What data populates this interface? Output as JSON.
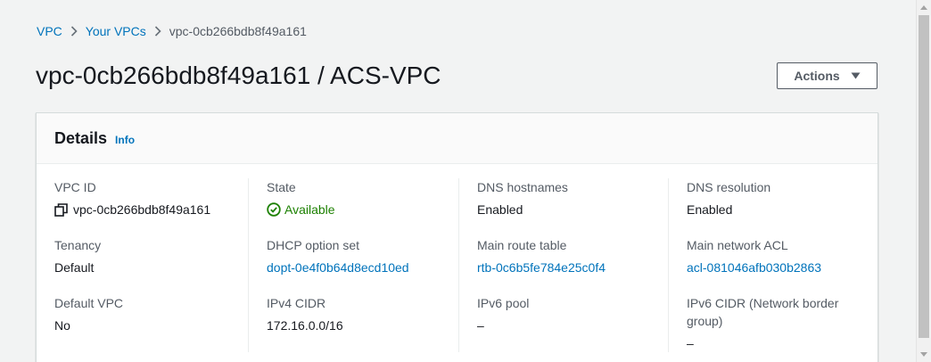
{
  "breadcrumb": {
    "items": [
      {
        "label": "VPC"
      },
      {
        "label": "Your VPCs"
      }
    ],
    "current": "vpc-0cb266bdb8f49a161"
  },
  "page_title": "vpc-0cb266bdb8f49a161 / ACS-VPC",
  "actions_button": {
    "label": "Actions",
    "icon": "caret-down-icon"
  },
  "details": {
    "title": "Details",
    "info_label": "Info",
    "columns": [
      [
        {
          "label": "VPC ID",
          "value": "vpc-0cb266bdb8f49a161",
          "icon": "copy-icon"
        },
        {
          "label": "Tenancy",
          "value": "Default"
        },
        {
          "label": "Default VPC",
          "value": "No"
        }
      ],
      [
        {
          "label": "State",
          "value": "Available",
          "icon": "check-circle-icon"
        },
        {
          "label": "DHCP option set",
          "value": "dopt-0e4f0b64d8ecd10ed",
          "link": true
        },
        {
          "label": "IPv4 CIDR",
          "value": "172.16.0.0/16"
        }
      ],
      [
        {
          "label": "DNS hostnames",
          "value": "Enabled"
        },
        {
          "label": "Main route table",
          "value": "rtb-0c6b5fe784e25c0f4",
          "link": true
        },
        {
          "label": "IPv6 pool",
          "value": "–"
        }
      ],
      [
        {
          "label": "DNS resolution",
          "value": "Enabled"
        },
        {
          "label": "Main network ACL",
          "value": "acl-081046afb030b2863",
          "link": true
        },
        {
          "label": "IPv6 CIDR (Network border group)",
          "value": "–"
        }
      ]
    ]
  },
  "colors": {
    "link": "#0073bb",
    "success": "#1d8102",
    "text": "#16191f",
    "label": "#545b64",
    "background": "#f2f3f3"
  }
}
